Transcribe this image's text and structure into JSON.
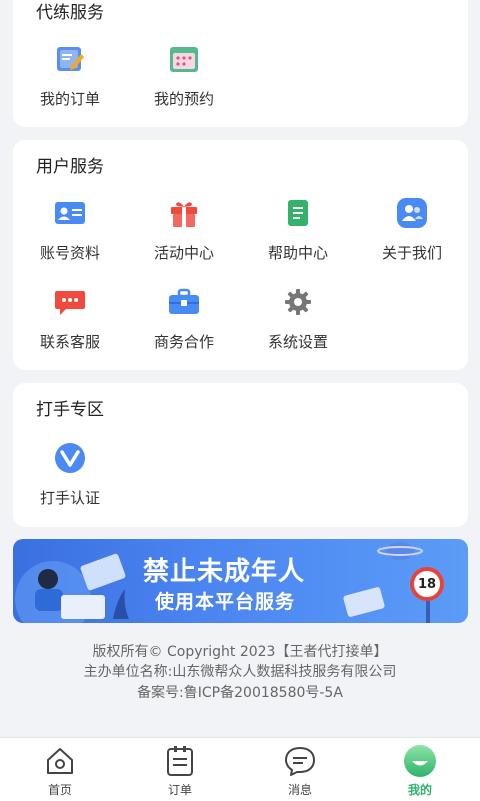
{
  "sections": {
    "daipei": {
      "title": "代练服务",
      "items": [
        {
          "label": "我的订单",
          "icon": "edit-note-icon"
        },
        {
          "label": "我的预约",
          "icon": "calendar-icon"
        }
      ]
    },
    "user": {
      "title": "用户服务",
      "items": [
        {
          "label": "账号资料",
          "icon": "id-card-icon"
        },
        {
          "label": "活动中心",
          "icon": "gift-icon"
        },
        {
          "label": "帮助中心",
          "icon": "document-icon"
        },
        {
          "label": "关于我们",
          "icon": "users-icon"
        },
        {
          "label": "联系客服",
          "icon": "chat-icon"
        },
        {
          "label": "商务合作",
          "icon": "briefcase-icon"
        },
        {
          "label": "系统设置",
          "icon": "gear-icon"
        }
      ]
    },
    "player": {
      "title": "打手专区",
      "items": [
        {
          "label": "打手认证",
          "icon": "verify-v-icon"
        }
      ]
    }
  },
  "banner": {
    "line1": "禁止未成年人",
    "line2": "使用本平台服务",
    "sign": "18"
  },
  "footer": {
    "copyright": "版权所有© Copyright 2023【王者代打接单】",
    "sponsor": "主办单位名称:山东微帮众人数据科技服务有限公司",
    "icp": "备案号:鲁ICP备20018580号-5A"
  },
  "tabbar": {
    "tabs": [
      {
        "label": "首页",
        "icon": "home-icon",
        "active": false
      },
      {
        "label": "订单",
        "icon": "order-list-icon",
        "active": false
      },
      {
        "label": "消息",
        "icon": "message-icon",
        "active": false
      },
      {
        "label": "我的",
        "icon": "profile-icon",
        "active": true
      }
    ]
  },
  "colors": {
    "accent": "#2db36b",
    "blue": "#4a8af4",
    "red": "#f0493e",
    "green": "#34b26a"
  }
}
